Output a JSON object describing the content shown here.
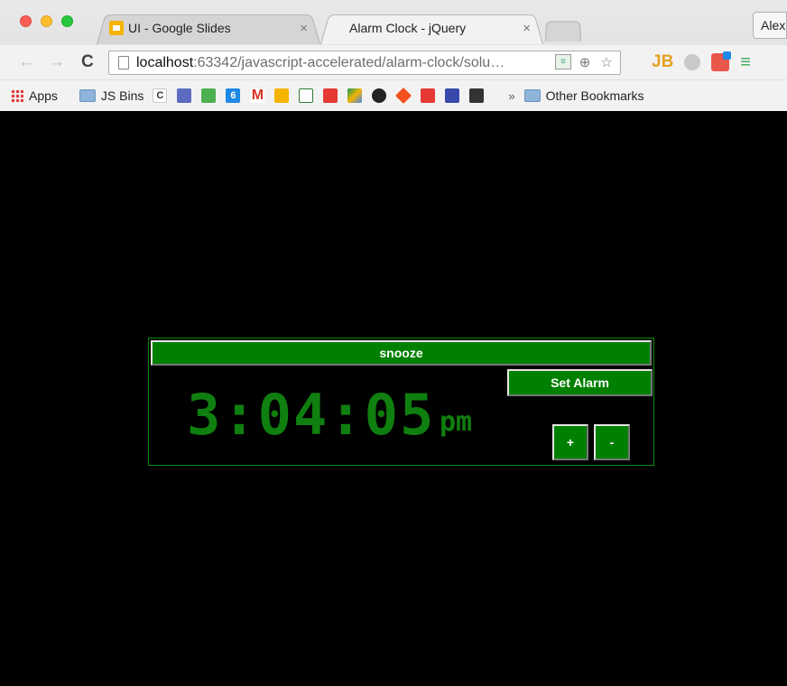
{
  "window": {
    "tabs": [
      {
        "title": "UI - Google Slides",
        "active": false,
        "icon": "google-slides-icon"
      },
      {
        "title": "Alarm Clock - jQuery",
        "active": true
      }
    ],
    "profile_name": "Alex"
  },
  "toolbar": {
    "url_host": "localhost",
    "url_rest": ":63342/javascript-accelerated/alarm-clock/solu…"
  },
  "bookmarks": {
    "apps_label": "Apps",
    "jsbins_label": "JS Bins",
    "c_label": "C",
    "other_label": "Other Bookmarks",
    "overflow": "»"
  },
  "clock": {
    "snooze_label": "snooze",
    "set_alarm_label": "Set Alarm",
    "time": "3:04:05",
    "meridiem": "pm",
    "plus_label": "+",
    "minus_label": "-",
    "color": "#008000"
  }
}
